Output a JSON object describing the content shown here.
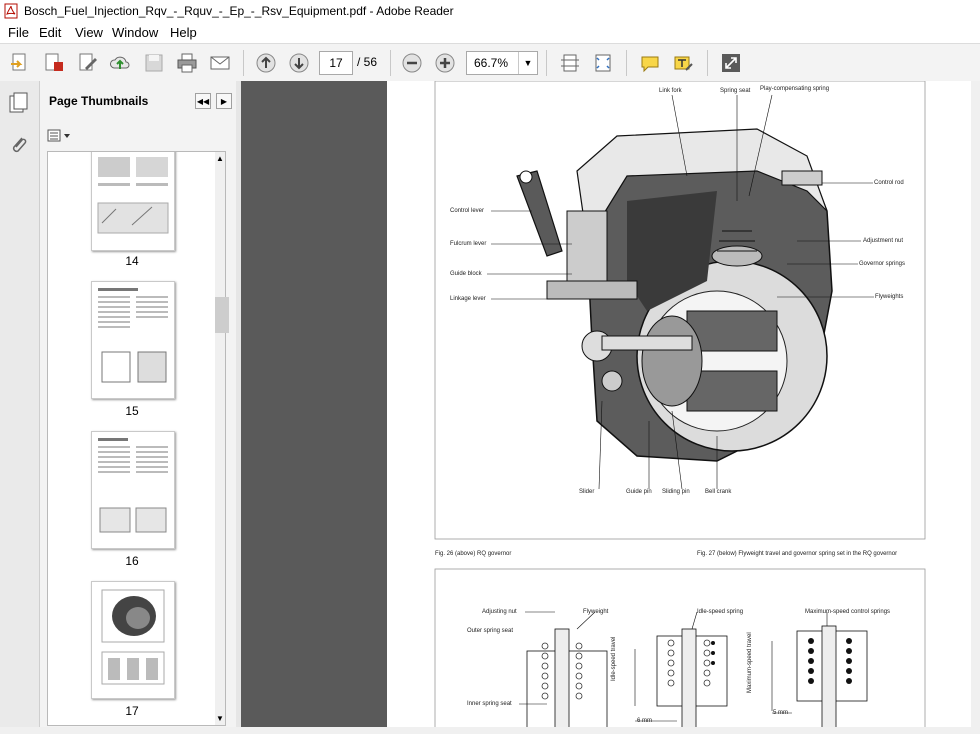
{
  "window": {
    "title": "Bosch_Fuel_Injection_Rqv_-_Rquv_-_Ep_-_Rsv_Equipment.pdf - Adobe Reader"
  },
  "menu": {
    "items": [
      "File",
      "Edit",
      "View",
      "Window",
      "Help"
    ]
  },
  "toolbar": {
    "current_page": "17",
    "total_pages": "/ 56",
    "zoom": "66.7%"
  },
  "nav": {
    "title": "Page Thumbnails",
    "thumbnails": [
      {
        "label": "14"
      },
      {
        "label": "15"
      },
      {
        "label": "16"
      },
      {
        "label": "17"
      }
    ]
  },
  "figure_top": {
    "labels": {
      "link_fork": "Link fork",
      "spring_seat": "Spring seat",
      "play_spring": "Play-compensating spring",
      "control_rod": "Control rod",
      "control_lever": "Control lever",
      "adjustment_nut": "Adjustment nut",
      "fulcrum_lever": "Fulcrum lever",
      "governor_springs": "Governor springs",
      "guide_block": "Guide block",
      "flyweights": "Flyweights",
      "linkage_lever": "Linkage lever",
      "slider": "Slider",
      "guide_pin": "Guide pin",
      "sliding_pin": "Sliding pin",
      "bell_crank": "Bell crank"
    },
    "caption_left": "Fig. 26 (above)   RQ governor",
    "caption_right": "Fig. 27 (below)   Flyweight travel and governor spring set in the RQ governor"
  },
  "figure_bottom": {
    "labels": {
      "adjusting_nut": "Adjusting nut",
      "flyweight": "Flyweight",
      "outer_spring_seat": "Outer spring seat",
      "idle_speed_spring": "Idle-speed spring",
      "max_speed_springs": "Maximum-speed control springs",
      "inner_spring_seat": "Inner spring seat",
      "idle_speed_travel": "Idle-speed travel",
      "max_speed_travel": "Maximum-speed travel",
      "mm6": "6 mm",
      "mm5": "5 mm"
    }
  }
}
